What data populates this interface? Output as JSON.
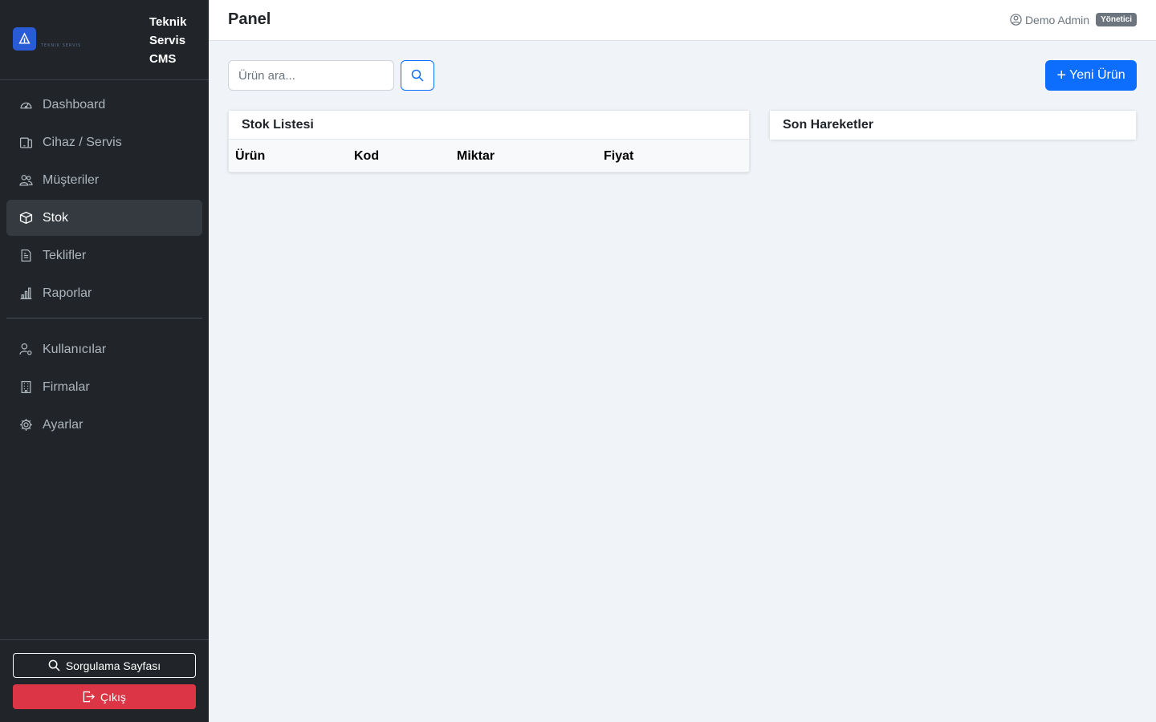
{
  "brand": {
    "logo_subtext": "TEKNIK SERVIS",
    "name": "Teknik Servis CMS",
    "name_lines": [
      "Teknik",
      "Servis",
      "CMS"
    ]
  },
  "sidebar": {
    "items": [
      {
        "label": "Dashboard",
        "icon": "speedometer-icon",
        "active": false
      },
      {
        "label": "Cihaz / Servis",
        "icon": "device-icon",
        "active": false
      },
      {
        "label": "Müşteriler",
        "icon": "people-icon",
        "active": false
      },
      {
        "label": "Stok",
        "icon": "box-icon",
        "active": true
      },
      {
        "label": "Teklifler",
        "icon": "document-icon",
        "active": false
      },
      {
        "label": "Raporlar",
        "icon": "bar-chart-icon",
        "active": false
      }
    ],
    "admin_items": [
      {
        "label": "Kullanıcılar",
        "icon": "user-gear-icon"
      },
      {
        "label": "Firmalar",
        "icon": "building-icon"
      },
      {
        "label": "Ayarlar",
        "icon": "gear-icon"
      }
    ],
    "footer": {
      "query_label": "Sorgulama Sayfası",
      "logout_label": "Çıkış"
    }
  },
  "header": {
    "title": "Panel",
    "user_name": "Demo Admin",
    "role": "Yönetici"
  },
  "toolbar": {
    "search_placeholder": "Ürün ara...",
    "new_label": "Yeni Ürün"
  },
  "stock_card": {
    "title": "Stok Listesi",
    "columns": [
      "Ürün",
      "Kod",
      "Miktar",
      "Fiyat"
    ]
  },
  "moves_card": {
    "title": "Son Hareketler"
  },
  "colors": {
    "sidebar_bg": "#212529",
    "primary": "#0d6efd",
    "danger": "#dc3545",
    "page_bg": "#f0f3f7"
  }
}
